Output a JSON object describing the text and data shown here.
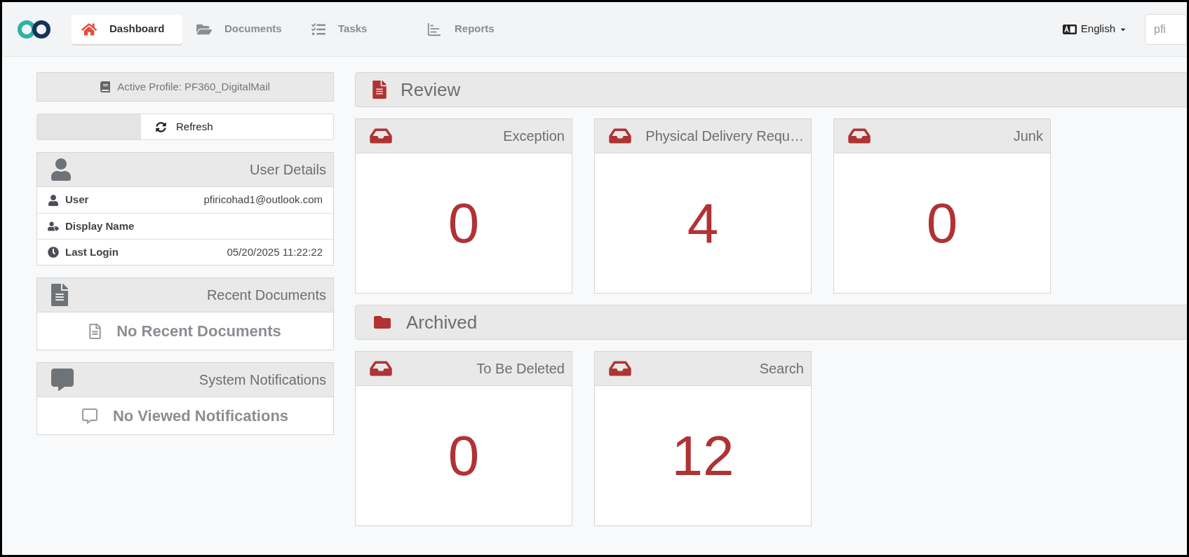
{
  "nav": {
    "tabs": [
      {
        "label": "Dashboard",
        "kind": "home",
        "selected": true
      },
      {
        "label": "Documents",
        "kind": "folder",
        "selected": false
      },
      {
        "label": "Tasks",
        "kind": "tasks",
        "selected": false
      },
      {
        "label": "Reports",
        "kind": "reports",
        "selected": false
      }
    ],
    "language": {
      "label": "English"
    },
    "search": {
      "placeholder": "pfi"
    }
  },
  "profile": {
    "text": "Active Profile: PF360_DigitalMail"
  },
  "refresh": {
    "label": "Refresh"
  },
  "user_details": {
    "title": "User Details",
    "rows": [
      {
        "kind": "user",
        "label": "User",
        "value": "pfiricohad1@outlook.com"
      },
      {
        "kind": "display",
        "label": "Display Name"
      },
      {
        "kind": "clock",
        "label": "Last Login",
        "value": "05/20/2025 11:22:22"
      }
    ]
  },
  "recent_documents": {
    "title": "Recent Documents",
    "empty": "No Recent Documents"
  },
  "system_notifications": {
    "title": "System Notifications",
    "empty": "No Viewed Notifications"
  },
  "sections": [
    {
      "title": "Review",
      "kind": "file",
      "tiles": [
        {
          "title": "Exception",
          "count": "0"
        },
        {
          "title": "Physical Delivery Requ…",
          "count": "4"
        },
        {
          "title": "Junk",
          "count": "0"
        }
      ]
    },
    {
      "title": "Archived",
      "kind": "folder",
      "tiles": [
        {
          "title": "To Be Deleted",
          "count": "0"
        },
        {
          "title": "Search",
          "count": "12"
        }
      ]
    }
  ]
}
